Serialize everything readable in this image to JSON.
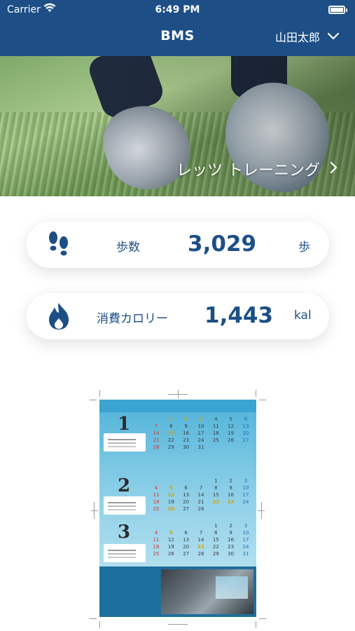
{
  "status_bar": {
    "carrier": "Carrier",
    "time": "6:49 PM"
  },
  "nav": {
    "title": "BMS",
    "user_name": "山田太郎"
  },
  "hero": {
    "link_label": "レッツ トレーニング"
  },
  "stats": {
    "steps": {
      "label": "歩数",
      "value": "3,029",
      "unit": "歩"
    },
    "calories": {
      "label": "消費カロリー",
      "value": "1,443",
      "unit": "kal"
    }
  },
  "poster": {
    "months": [
      "1",
      "2",
      "3"
    ]
  },
  "icons": {
    "wifi": "wifi-icon",
    "battery": "battery-icon",
    "chevron_down": "chevron-down-icon",
    "chevron_right": "chevron-right-icon",
    "footprints": "footprints-icon",
    "flame": "flame-icon"
  },
  "colors": {
    "primary": "#1d4f86",
    "card_bg": "#ffffff"
  }
}
